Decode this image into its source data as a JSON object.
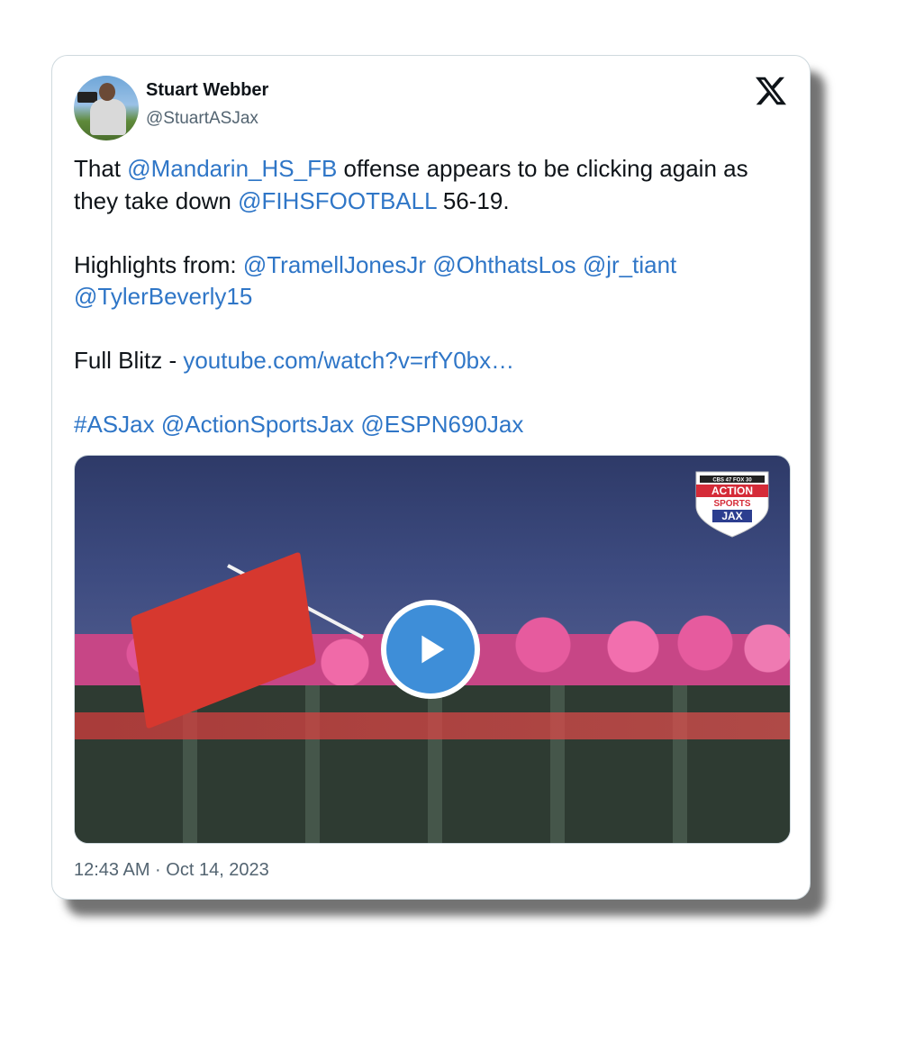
{
  "author": {
    "name": "Stuart Webber",
    "handle": "@StuartASJax"
  },
  "tweet": {
    "p1": {
      "t1": "That ",
      "mention1": "@Mandarin_HS_FB",
      "t2": " offense appears to be clicking again as they take down ",
      "mention2": "@FIHSFOOTBALL",
      "t3": " 56-19."
    },
    "p2": {
      "t1": "Highlights from: ",
      "m1": "@TramellJonesJr",
      "m2": "@OhthatsLos",
      "m3": "@jr_tiant",
      "m4": "@TylerBeverly15"
    },
    "p3": {
      "t1": "Full Blitz - ",
      "link": "youtube.com/watch?v=rfY0bx…"
    },
    "p4": {
      "h1": "#ASJax",
      "m1": "@ActionSportsJax",
      "m2": "@ESPN690Jax"
    }
  },
  "media": {
    "logo_top": "CBS 47  FOX 30",
    "logo_line1": "ACTION",
    "logo_line2": "SPORTS",
    "logo_line3": "JAX"
  },
  "timestamp": "12:43 AM · Oct 14, 2023",
  "colors": {
    "link": "#2f76c7",
    "play": "#3e8ed8"
  },
  "icons": [
    "x-logo-icon",
    "play-icon"
  ]
}
